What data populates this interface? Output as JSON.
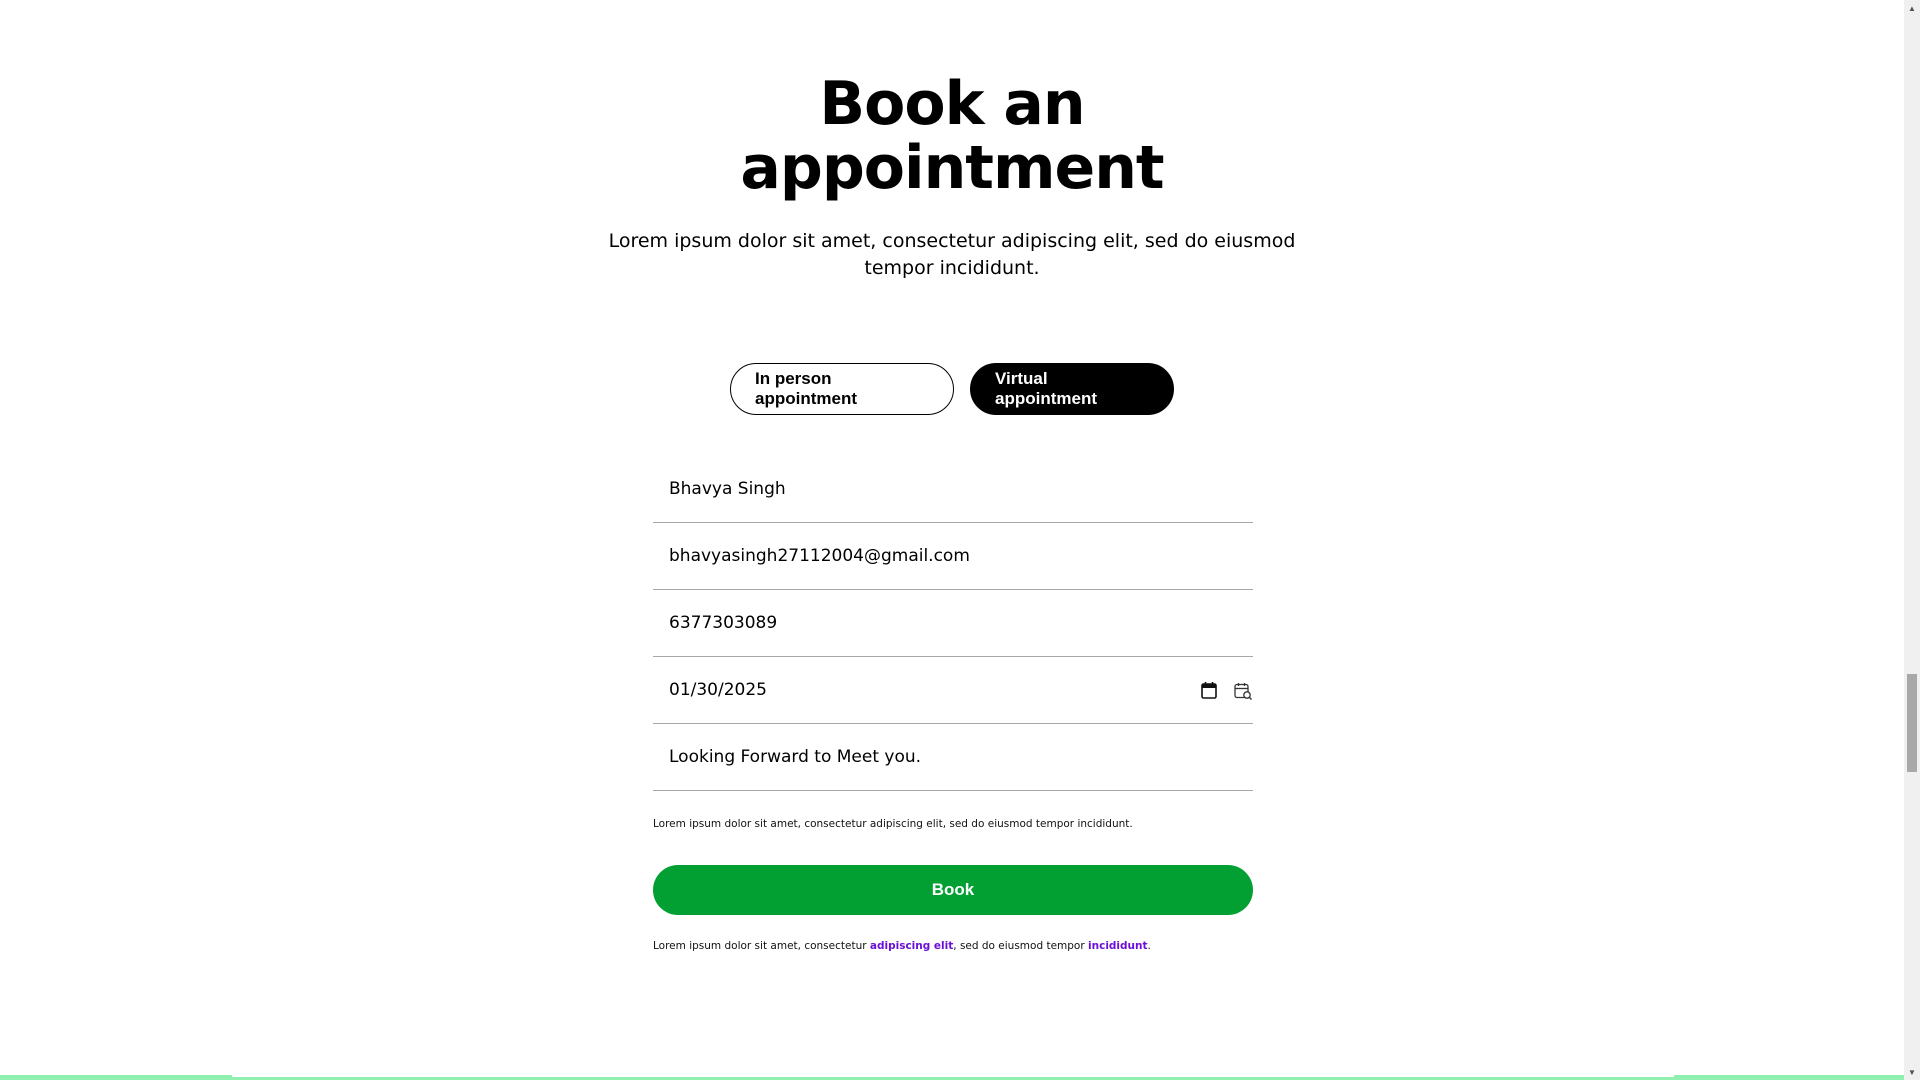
{
  "header": {
    "title_line1": "Book an",
    "title_line2": "appointment",
    "subtitle": "Lorem ipsum dolor sit amet, consectetur adipiscing elit, sed do eiusmod tempor incididunt."
  },
  "toggle": {
    "in_person_label": "In person appointment",
    "virtual_label": "Virtual appointment",
    "selected": "Virtual appointment"
  },
  "form": {
    "name_value": "Bhavya Singh",
    "email_value": "bhavyasingh27112004@gmail.com",
    "phone_value": "6377303089",
    "date_value": "01/30/2025",
    "message_value": "Looking Forward to Meet you."
  },
  "note": "Lorem ipsum dolor sit amet, consectetur adipiscing elit, sed do eiusmod tempor incididunt.",
  "book_label": "Book",
  "footnote": {
    "prefix": "Lorem ipsum dolor sit amet, consectetur ",
    "link1": "adipiscing elit",
    "middle": ", sed do eiusmod tempor ",
    "link2": "incididunt",
    "suffix": "."
  },
  "colors": {
    "book_button": "#02a032",
    "link": "#6a0fd8",
    "bottom_strip": "#8ff0b0"
  },
  "icons": {
    "date_field": "calendar-icon",
    "date_picker": "calendar-search-icon"
  }
}
